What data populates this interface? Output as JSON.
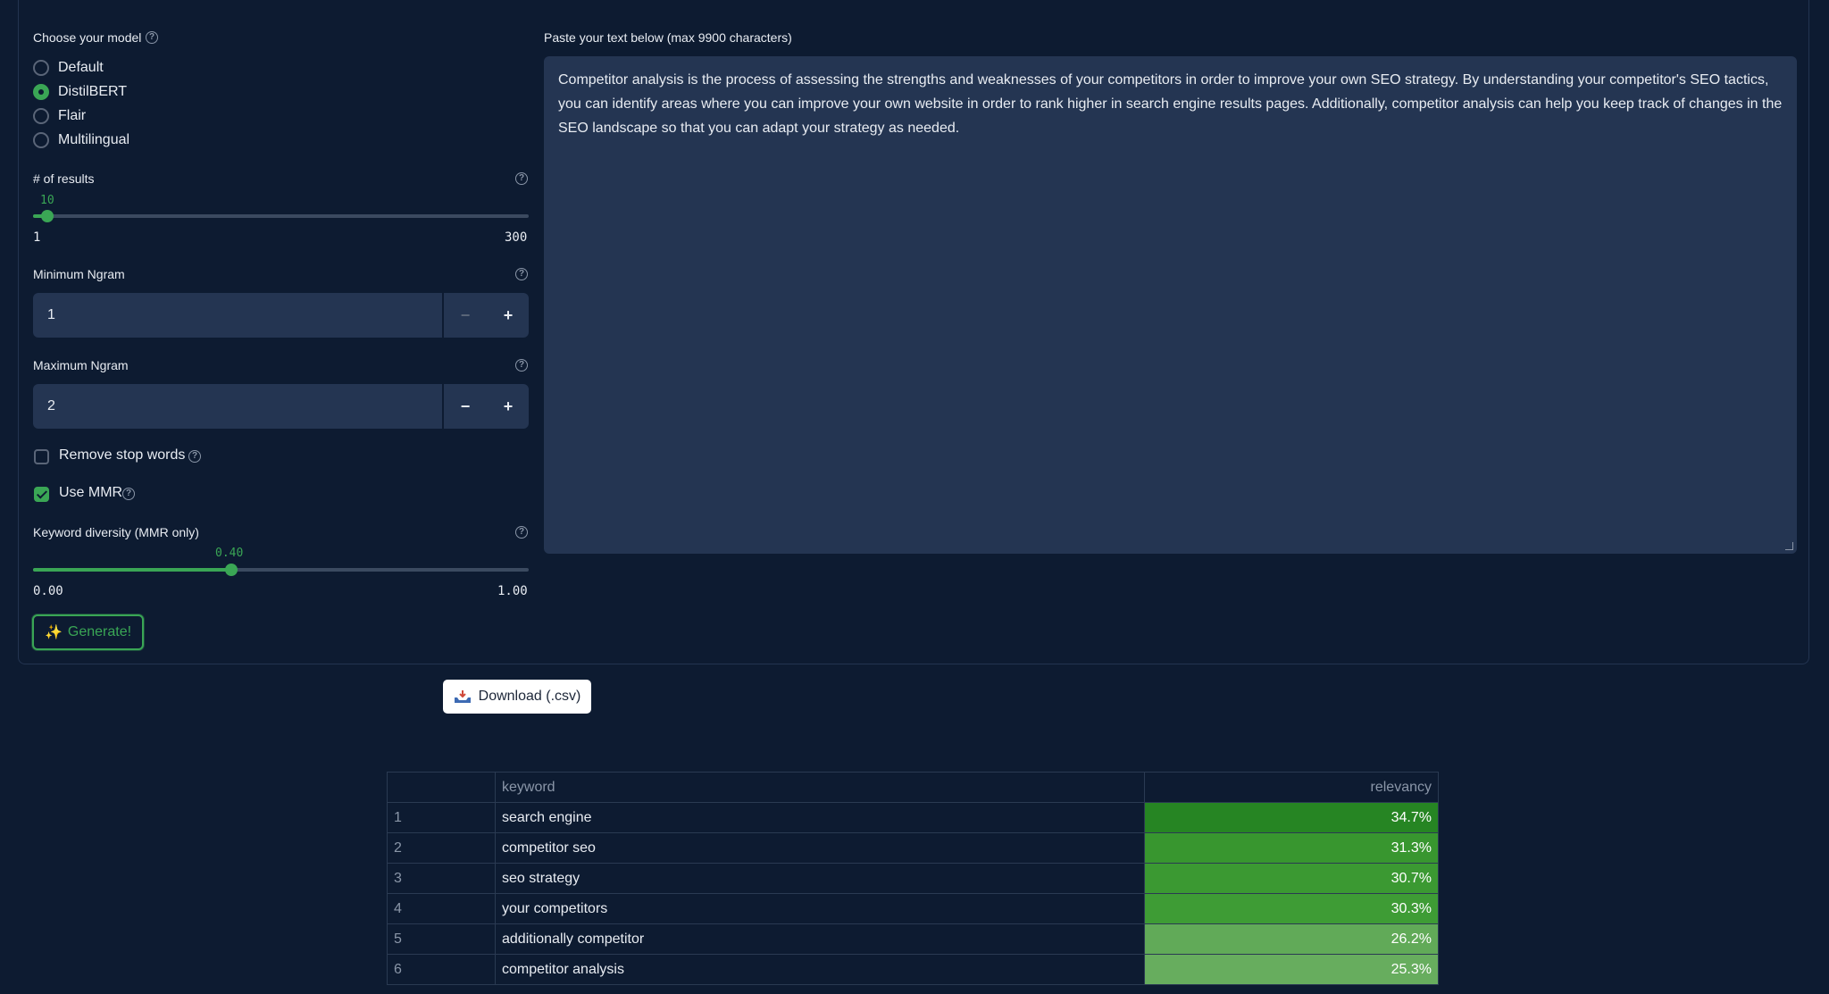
{
  "model": {
    "label": "Choose your model",
    "options": [
      "Default",
      "DistilBERT",
      "Flair",
      "Multilingual"
    ],
    "selected": "DistilBERT"
  },
  "results_slider": {
    "label": "# of results",
    "value": "10",
    "min": "1",
    "max": "300",
    "fraction": 0.03
  },
  "min_ngram": {
    "label": "Minimum Ngram",
    "value": "1",
    "minus": "−",
    "plus": "+"
  },
  "max_ngram": {
    "label": "Maximum Ngram",
    "value": "2",
    "minus": "−",
    "plus": "+"
  },
  "remove_stop_words": {
    "label": "Remove stop words",
    "checked": false
  },
  "use_mmr": {
    "label": "Use MMR",
    "checked": true
  },
  "diversity_slider": {
    "label": "Keyword diversity (MMR only)",
    "value": "0.40",
    "min": "0.00",
    "max": "1.00",
    "fraction": 0.4
  },
  "generate": {
    "icon": "✨",
    "label": "Generate!"
  },
  "text_input": {
    "label": "Paste your text below (max 9900 characters)",
    "value": "Competitor analysis is the process of assessing the strengths and weaknesses of your competitors in order to improve your own SEO strategy. By understanding your competitor's SEO tactics, you can identify areas where you can improve your own website in order to rank higher in search engine results pages. Additionally, competitor analysis can help you keep track of changes in the SEO landscape so that you can adapt your strategy as needed."
  },
  "download": {
    "label": "Download (.csv)"
  },
  "table": {
    "headers": {
      "index": "",
      "keyword": "keyword",
      "relevancy": "relevancy"
    },
    "rows": [
      {
        "index": "1",
        "keyword": "search engine",
        "relevancy": "34.7%",
        "color": "#268523"
      },
      {
        "index": "2",
        "keyword": "competitor seo",
        "relevancy": "31.3%",
        "color": "#38962f"
      },
      {
        "index": "3",
        "keyword": "seo strategy",
        "relevancy": "30.7%",
        "color": "#3b9932"
      },
      {
        "index": "4",
        "keyword": "your competitors",
        "relevancy": "30.3%",
        "color": "#3e9c35"
      },
      {
        "index": "5",
        "keyword": "additionally competitor",
        "relevancy": "26.2%",
        "color": "#61aa58"
      },
      {
        "index": "6",
        "keyword": "competitor analysis",
        "relevancy": "25.3%",
        "color": "#67ad5e"
      }
    ]
  },
  "colors": {
    "background": "#0d1b31",
    "input": "#243552",
    "accent": "#3aa655"
  }
}
